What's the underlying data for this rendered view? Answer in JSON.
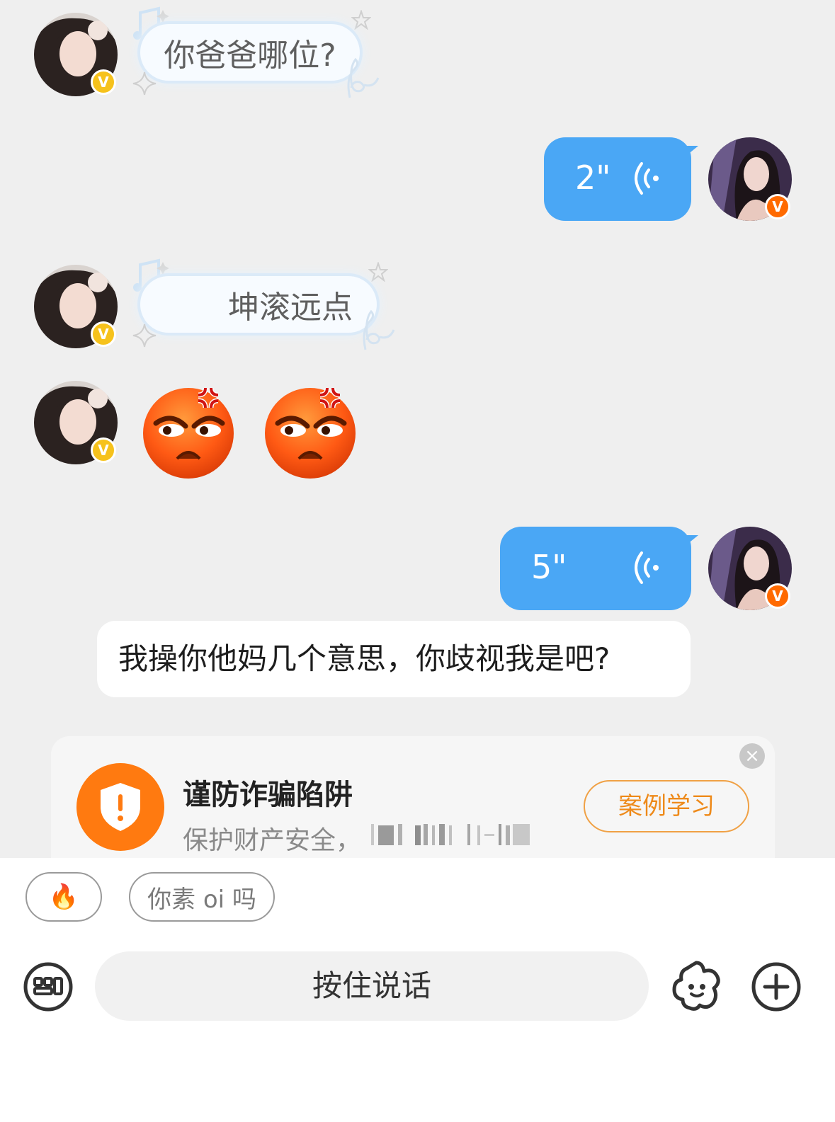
{
  "messages": {
    "m1": {
      "text": "你爸爸哪位?"
    },
    "m2": {
      "duration": "2\""
    },
    "m3": {
      "text": "坤滚远点"
    },
    "m5": {
      "duration": "5\""
    },
    "m6": {
      "text": "我操你他妈几个意思，你歧视我是吧?"
    }
  },
  "badge_letter": "V",
  "fraud_card": {
    "title": "谨防诈骗陷阱",
    "subtitle": "保护财产安全，",
    "button": "案例学习",
    "close": "×"
  },
  "quick_replies": [
    {
      "label": "🔥"
    },
    {
      "label": "你素 oi 吗"
    }
  ],
  "input": {
    "hold_to_talk": "按住说话"
  },
  "colors": {
    "voice_bubble": "#4aa7f5",
    "accent_orange": "#ff7a10",
    "verified_yellow": "#f6c21c",
    "verified_orange": "#ff6a00",
    "background": "#efefef"
  },
  "icons": [
    "keyboard-icon",
    "sticker-icon",
    "plus-icon",
    "voice-wave-icon",
    "shield-icon",
    "angry-emoji-icon",
    "close-icon"
  ]
}
